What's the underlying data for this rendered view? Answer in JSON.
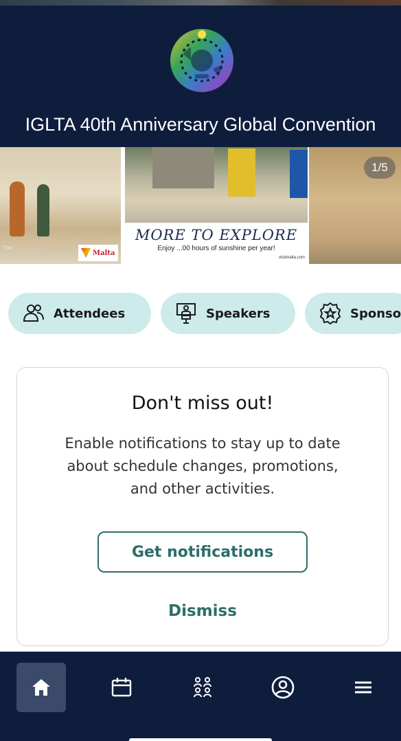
{
  "header": {
    "event_title": "IGLTA 40th Anniversary Global Convention",
    "logo_icon": "iglta-logo-icon"
  },
  "banner": {
    "page_indicator": "1/5",
    "headline": "MORE TO EXPLORE",
    "subline": "Enjoy ...00 hours of sunshine per year!",
    "url": "visitmalta.com",
    "brand": "Malta",
    "credit": "The ... ... ... ..."
  },
  "quick_actions": [
    {
      "label": "Attendees",
      "icon": "attendees-icon"
    },
    {
      "label": "Speakers",
      "icon": "speakers-icon"
    },
    {
      "label": "Sponso",
      "icon": "sponsors-icon"
    }
  ],
  "notification_card": {
    "title": "Don't miss out!",
    "body": "Enable notifications to stay up to date about schedule changes, promotions, and other activities.",
    "primary_button": "Get notifications",
    "secondary_button": "Dismiss"
  },
  "bottom_nav": [
    {
      "name": "home",
      "icon": "home-icon",
      "active": true
    },
    {
      "name": "calendar",
      "icon": "calendar-icon",
      "active": false
    },
    {
      "name": "attendees",
      "icon": "attendees-grid-icon",
      "active": false
    },
    {
      "name": "profile",
      "icon": "profile-icon",
      "active": false
    },
    {
      "name": "menu",
      "icon": "menu-icon",
      "active": false
    }
  ],
  "colors": {
    "header_bg": "#0f1d3d",
    "chip_bg": "#cdebeb",
    "accent_teal": "#2c6e69",
    "nav_active_bg": "#3b4a68"
  }
}
